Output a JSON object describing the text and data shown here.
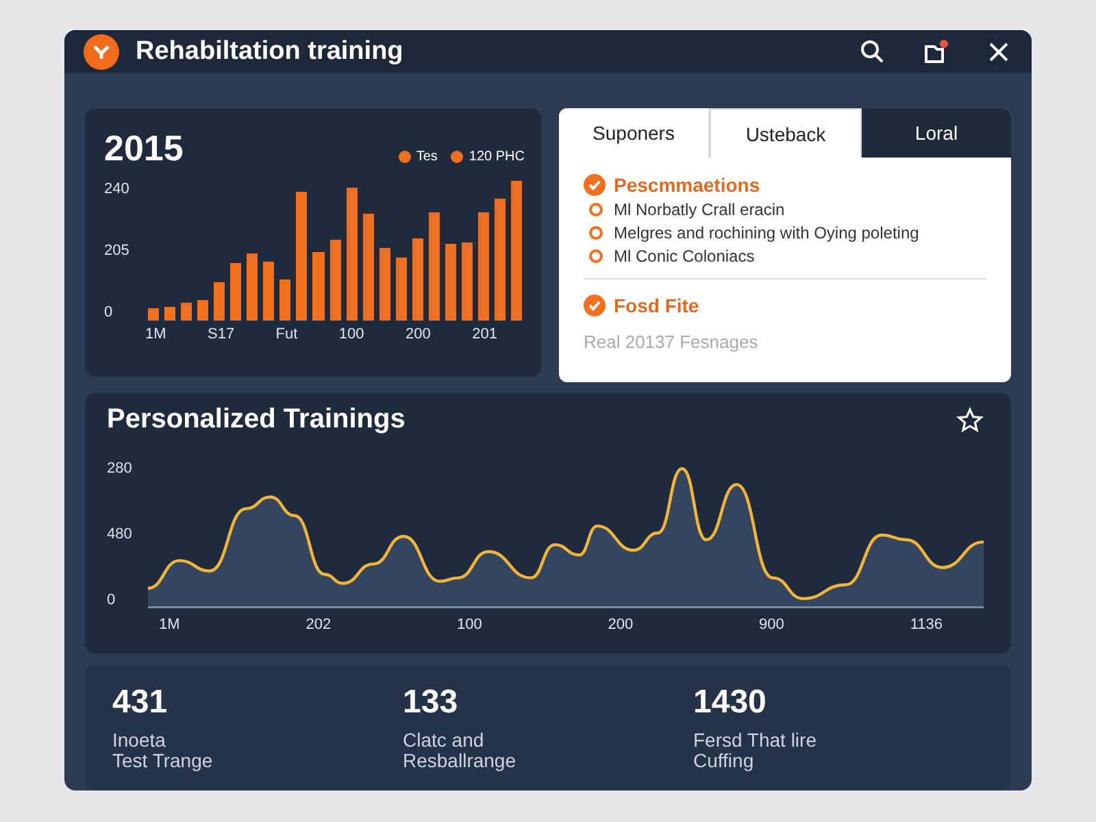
{
  "window": {
    "title": "Rehabiltation training"
  },
  "bar_panel": {
    "year": "2015",
    "legend": [
      {
        "label": "Tes"
      },
      {
        "label": "120 PHC"
      }
    ],
    "y_labels": [
      "240",
      "205",
      "0"
    ],
    "x_labels": [
      "1M",
      "S17",
      "Fut",
      "100",
      "200",
      "201"
    ]
  },
  "tabs": [
    {
      "label": "Suponers",
      "selected": false
    },
    {
      "label": "Usteback",
      "selected": true
    },
    {
      "label": "Loral",
      "selected": false
    }
  ],
  "sections": [
    {
      "title": "Pescmmaetions",
      "items": [
        "Ml Norbatly Crall eracin",
        "Melgres and rochining with Oying poleting",
        "Ml Conic Coloniacs"
      ]
    },
    {
      "title": "Fosd Fite"
    }
  ],
  "panel_footer": "Real 20137 Fesnages",
  "line_panel": {
    "title": "Personalized Trainings",
    "y_labels": [
      "280",
      "480",
      "0"
    ],
    "x_labels": [
      "1M",
      "202",
      "100",
      "200",
      "900",
      "1136"
    ]
  },
  "stats": [
    {
      "value": "431",
      "label": "Inoeta\nTest Trange"
    },
    {
      "value": "133",
      "label": "Clatc and\nResballrange"
    },
    {
      "value": "1430",
      "label": "Fersd That lire\nCuffing"
    }
  ]
}
